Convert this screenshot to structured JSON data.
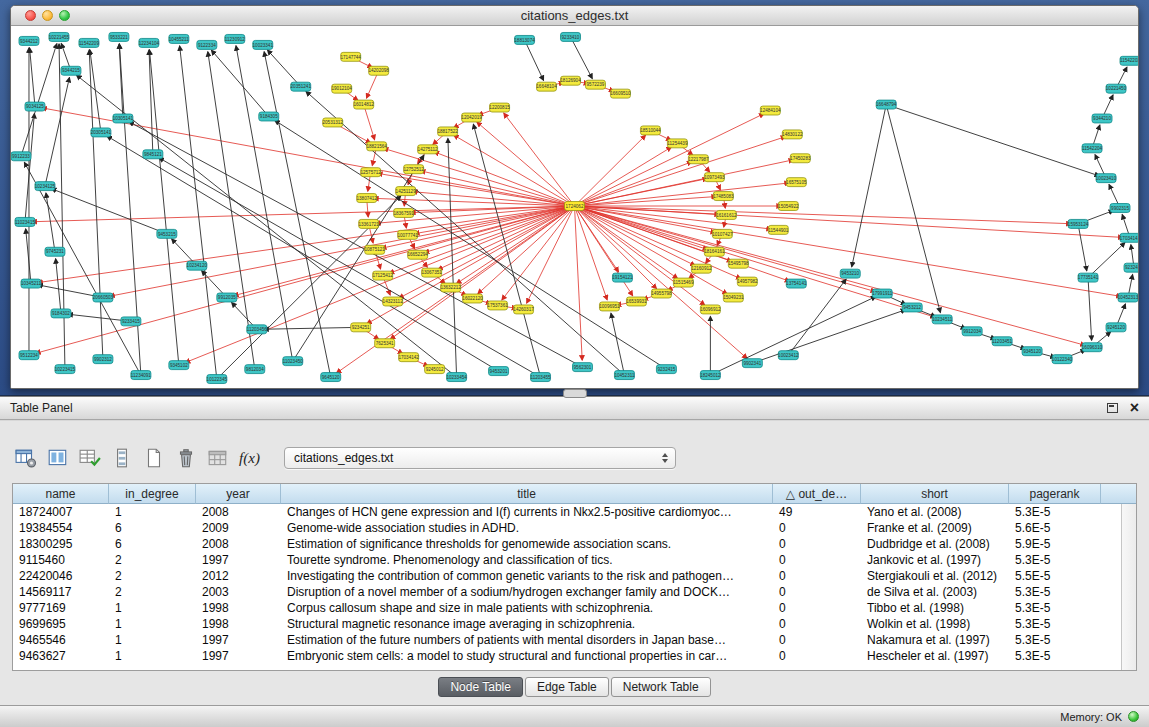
{
  "window": {
    "title": "citations_edges.txt"
  },
  "table_panel": {
    "title": "Table Panel",
    "close_glyph": "×",
    "toolbar": {
      "icons": [
        "table-settings-icon",
        "select-columns-icon",
        "edit-table-icon",
        "rows-icon",
        "new-table-icon",
        "delete-table-icon",
        "import-table-icon",
        "function-builder-icon"
      ],
      "fx_label": "f(x)",
      "table_selector": "citations_edges.txt"
    },
    "table": {
      "sort_glyph": "△",
      "columns": [
        {
          "key": "name",
          "label": "name"
        },
        {
          "key": "in_degree",
          "label": "in_degree"
        },
        {
          "key": "year",
          "label": "year"
        },
        {
          "key": "title",
          "label": "title"
        },
        {
          "key": "out_degree",
          "label": "out_de…",
          "sorted": true
        },
        {
          "key": "short",
          "label": "short"
        },
        {
          "key": "pagerank",
          "label": "pagerank"
        }
      ],
      "rows": [
        [
          "18724007",
          "1",
          "2008",
          "Changes of HCN gene expression and I(f) currents in Nkx2.5-positive cardiomyoc…",
          "49",
          "Yano et al. (2008)",
          "5.3E-5"
        ],
        [
          "19384554",
          "6",
          "2009",
          "Genome-wide association studies in ADHD.",
          "0",
          "Franke et al. (2009)",
          "5.6E-5"
        ],
        [
          "18300295",
          "6",
          "2008",
          "Estimation of significance thresholds for genomewide association scans.",
          "0",
          "Dudbridge et al. (2008)",
          "5.9E-5"
        ],
        [
          "9115460",
          "2",
          "1997",
          "Tourette syndrome. Phenomenology and classification of tics.",
          "0",
          "Jankovic et al. (1997)",
          "5.3E-5"
        ],
        [
          "22420046",
          "2",
          "2012",
          "Investigating the contribution of common genetic variants to the risk and pathogen…",
          "0",
          "Stergiakouli et al. (2012)",
          "5.5E-5"
        ],
        [
          "14569117",
          "2",
          "2003",
          "Disruption of a novel member of a sodium/hydrogen exchanger family and DOCK…",
          "0",
          "de Silva et al. (2003)",
          "5.3E-5"
        ],
        [
          "9777169",
          "1",
          "1998",
          "Corpus callosum shape and size in male patients with schizophrenia.",
          "0",
          "Tibbo et al. (1998)",
          "5.3E-5"
        ],
        [
          "9699695",
          "1",
          "1998",
          "Structural magnetic resonance image averaging in schizophrenia.",
          "0",
          "Wolkin et al. (1998)",
          "5.3E-5"
        ],
        [
          "9465546",
          "1",
          "1997",
          "Estimation of the future numbers of patients with mental disorders in Japan base…",
          "0",
          "Nakamura et al. (1997)",
          "5.3E-5"
        ],
        [
          "9463627",
          "1",
          "1997",
          "Embryonic stem cells: a model to study structural and functional properties in car…",
          "0",
          "Hescheler et al. (1997)",
          "5.3E-5"
        ]
      ]
    },
    "tabs": [
      {
        "label": "Node Table",
        "selected": true
      },
      {
        "label": "Edge Table",
        "selected": false
      },
      {
        "label": "Network Table",
        "selected": false
      }
    ]
  },
  "status_bar": {
    "memory_label": "Memory: OK"
  },
  "colors": {
    "node_teal": "#3ec6c6",
    "node_teal_border": "#0c8888",
    "node_yellow": "#f4ea3e",
    "node_yellow_border": "#96960f",
    "hub_yellow": "#ffe92e",
    "edge_red": "#e03028",
    "edge_black": "#2a2a2a"
  },
  "network": {
    "hub_index": 0,
    "nodes": [
      [
        564,
        180,
        "y",
        "1724062"
      ],
      [
        640,
        104,
        "y",
        "18510044"
      ],
      [
        667,
        117,
        "y",
        "11254439"
      ],
      [
        688,
        133,
        "y",
        "12217987"
      ],
      [
        704,
        151,
        "y",
        "10973493"
      ],
      [
        713,
        170,
        "y",
        "17485083"
      ],
      [
        716,
        189,
        "y",
        "16161612"
      ],
      [
        712,
        208,
        "y",
        "10107427"
      ],
      [
        704,
        226,
        "y",
        "18164161"
      ],
      [
        691,
        243,
        "y",
        "12160912"
      ],
      [
        673,
        257,
        "y",
        "11515469"
      ],
      [
        651,
        268,
        "y",
        "14955798"
      ],
      [
        626,
        276,
        "y",
        "16539931"
      ],
      [
        599,
        281,
        "y",
        "10096951"
      ],
      [
        489,
        81,
        "y",
        "12200815"
      ],
      [
        461,
        91,
        "y",
        "12042019"
      ],
      [
        437,
        105,
        "y",
        "18817522"
      ],
      [
        417,
        123,
        "y",
        "14275112"
      ],
      [
        403,
        143,
        "y",
        "12752512"
      ],
      [
        395,
        165,
        "y",
        "14251129"
      ],
      [
        393,
        187,
        "y",
        "18367591"
      ],
      [
        397,
        209,
        "y",
        "10077741"
      ],
      [
        407,
        229,
        "y",
        "16652294"
      ],
      [
        421,
        247,
        "y",
        "13067351"
      ],
      [
        440,
        262,
        "y",
        "13632212"
      ],
      [
        462,
        273,
        "y",
        "16022120"
      ],
      [
        487,
        280,
        "y",
        "17537361"
      ],
      [
        513,
        284,
        "y",
        "14260317"
      ],
      [
        536,
        60,
        "y",
        "16648104"
      ],
      [
        560,
        54,
        "y",
        "18126904"
      ],
      [
        585,
        58,
        "y",
        "9572239"
      ],
      [
        610,
        67,
        "y",
        "16609510"
      ],
      [
        340,
        30,
        "y",
        "17147744"
      ],
      [
        368,
        44,
        "y",
        "14202098"
      ],
      [
        331,
        62,
        "y",
        "19012104"
      ],
      [
        353,
        78,
        "y",
        "16014812"
      ],
      [
        322,
        96,
        "y",
        "20531312"
      ],
      [
        366,
        120,
        "y",
        "18821564"
      ],
      [
        360,
        146,
        "y",
        "12575712"
      ],
      [
        356,
        172,
        "y",
        "13807412"
      ],
      [
        358,
        198,
        "y",
        "13361721"
      ],
      [
        364,
        224,
        "y",
        "10875121"
      ],
      [
        372,
        250,
        "y",
        "17125412"
      ],
      [
        382,
        276,
        "y",
        "14323112"
      ],
      [
        760,
        84,
        "y",
        "12484104"
      ],
      [
        782,
        108,
        "y",
        "14830122"
      ],
      [
        790,
        132,
        "y",
        "17450283"
      ],
      [
        786,
        156,
        "y",
        "16575105"
      ],
      [
        778,
        180,
        "y",
        "15054922"
      ],
      [
        768,
        204,
        "y",
        "11544901"
      ],
      [
        350,
        302,
        "y",
        "9234251"
      ],
      [
        374,
        318,
        "y",
        "7625341"
      ],
      [
        398,
        332,
        "y",
        "17034142"
      ],
      [
        424,
        344,
        "y",
        "9245012"
      ],
      [
        728,
        238,
        "y",
        "15495798"
      ],
      [
        737,
        256,
        "y",
        "14957982"
      ],
      [
        723,
        272,
        "y",
        "15049231"
      ],
      [
        700,
        284,
        "y",
        "16096912"
      ],
      [
        18,
        14,
        "t",
        "9344212"
      ],
      [
        48,
        10,
        "t",
        "10221455"
      ],
      [
        78,
        16,
        "t",
        "11542209"
      ],
      [
        108,
        10,
        "t",
        "9533221"
      ],
      [
        138,
        16,
        "t",
        "12234104"
      ],
      [
        168,
        12,
        "t",
        "10455211"
      ],
      [
        196,
        18,
        "t",
        "9122334"
      ],
      [
        224,
        12,
        "t",
        "11230912"
      ],
      [
        252,
        18,
        "t",
        "10023341"
      ],
      [
        24,
        80,
        "t",
        "9034125"
      ],
      [
        10,
        130,
        "t",
        "9912233"
      ],
      [
        34,
        160,
        "t",
        "10234125"
      ],
      [
        14,
        196,
        "t",
        "11023415"
      ],
      [
        44,
        226,
        "t",
        "9745231"
      ],
      [
        20,
        258,
        "t",
        "10345211"
      ],
      [
        50,
        288,
        "t",
        "9184302"
      ],
      [
        92,
        272,
        "t",
        "20660503"
      ],
      [
        120,
        296,
        "t",
        "9233415"
      ],
      [
        18,
        330,
        "t",
        "9512234"
      ],
      [
        54,
        344,
        "t",
        "10223415"
      ],
      [
        92,
        334,
        "t",
        "9902312"
      ],
      [
        130,
        350,
        "t",
        "11234091"
      ],
      [
        168,
        340,
        "t",
        "9345102"
      ],
      [
        206,
        354,
        "t",
        "10122345"
      ],
      [
        244,
        344,
        "t",
        "9812034"
      ],
      [
        282,
        336,
        "t",
        "11023450"
      ],
      [
        320,
        352,
        "t",
        "9645120"
      ],
      [
        446,
        352,
        "t",
        "10233454"
      ],
      [
        488,
        346,
        "t",
        "9453201"
      ],
      [
        530,
        352,
        "t",
        "11203455"
      ],
      [
        572,
        342,
        "t",
        "9562301"
      ],
      [
        614,
        350,
        "t",
        "10452311"
      ],
      [
        656,
        344,
        "t",
        "9232415"
      ],
      [
        700,
        350,
        "t",
        "18245012"
      ],
      [
        742,
        338,
        "t",
        "9902341"
      ],
      [
        778,
        330,
        "t",
        "10023412"
      ],
      [
        872,
        268,
        "t",
        "17991911"
      ],
      [
        902,
        282,
        "t",
        "9453212"
      ],
      [
        932,
        294,
        "t",
        "10234511"
      ],
      [
        962,
        306,
        "t",
        "9912034"
      ],
      [
        992,
        316,
        "t",
        "11203451"
      ],
      [
        1022,
        326,
        "t",
        "9345120"
      ],
      [
        1052,
        334,
        "t",
        "10122340"
      ],
      [
        1082,
        322,
        "t",
        "16096310"
      ],
      [
        1106,
        302,
        "t",
        "9245120"
      ],
      [
        1118,
        272,
        "t",
        "10452313"
      ],
      [
        1124,
        242,
        "t",
        "9232410"
      ],
      [
        1120,
        212,
        "t",
        "17034141"
      ],
      [
        1110,
        182,
        "t",
        "9902315"
      ],
      [
        1096,
        152,
        "t",
        "10023410"
      ],
      [
        1082,
        122,
        "t",
        "11542204"
      ],
      [
        1092,
        92,
        "t",
        "9344210"
      ],
      [
        1106,
        62,
        "t",
        "10221450"
      ],
      [
        1120,
        34,
        "t",
        "11542203"
      ],
      [
        1078,
        252,
        "t",
        "17735141"
      ],
      [
        876,
        78,
        "t",
        "16648794"
      ],
      [
        1068,
        198,
        "t",
        "15953124"
      ],
      [
        840,
        248,
        "t",
        "9453210"
      ],
      [
        612,
        252,
        "t",
        "19154121"
      ],
      [
        786,
        258,
        "t",
        "13754141"
      ],
      [
        90,
        106,
        "t",
        "20305141"
      ],
      [
        142,
        128,
        "t",
        "9845121"
      ],
      [
        112,
        92,
        "t",
        "10305141"
      ],
      [
        60,
        44,
        "t",
        "9344215"
      ],
      [
        514,
        13,
        "t",
        "18813074"
      ],
      [
        560,
        10,
        "t",
        "9233410"
      ],
      [
        290,
        60,
        "t",
        "20351241"
      ],
      [
        258,
        90,
        "t",
        "9184305"
      ],
      [
        156,
        208,
        "t",
        "9453215"
      ],
      [
        186,
        240,
        "t",
        "10234120"
      ],
      [
        216,
        272,
        "t",
        "9912035"
      ],
      [
        246,
        304,
        "t",
        "11203456"
      ]
    ],
    "edges": {
      "red_spokes_from": 0,
      "red_spokes_to": [
        1,
        2,
        3,
        4,
        5,
        6,
        7,
        8,
        9,
        10,
        11,
        12,
        13,
        14,
        15,
        16,
        17,
        18,
        19,
        20,
        21,
        22,
        23,
        24,
        25,
        26,
        27,
        37,
        38,
        39,
        40,
        41,
        42,
        43,
        44,
        45,
        46,
        47,
        48,
        49,
        54,
        55,
        56,
        57,
        67,
        70,
        72,
        74,
        76,
        80,
        84,
        88,
        92,
        94,
        96,
        101,
        103,
        105,
        114,
        116,
        117,
        50,
        51,
        128
      ],
      "red_chains": [
        [
          1,
          2,
          3,
          4,
          5,
          6,
          7,
          8,
          9,
          10,
          11,
          12,
          13
        ],
        [
          14,
          15,
          16,
          17,
          18,
          19,
          20,
          21,
          22,
          23,
          24,
          25,
          26,
          27
        ],
        [
          28,
          29,
          30,
          31
        ],
        [
          37,
          38,
          39,
          40,
          41,
          42,
          43
        ],
        [
          32,
          33,
          35,
          37
        ],
        [
          34,
          35
        ],
        [
          36,
          37
        ],
        [
          50,
          51,
          52,
          53
        ]
      ],
      "black_chains": [
        [
          94,
          95,
          96,
          97,
          98,
          99,
          100,
          101,
          102,
          103,
          104,
          105,
          106,
          107,
          108,
          109,
          110,
          111
        ],
        [
          75,
          73,
          71,
          69,
          121
        ],
        [
          74,
          72,
          70,
          67,
          58
        ],
        [
          129,
          128,
          127,
          126,
          69
        ]
      ],
      "black_pairs": [
        [
          76,
          58
        ],
        [
          77,
          59
        ],
        [
          78,
          60
        ],
        [
          79,
          61
        ],
        [
          80,
          62
        ],
        [
          81,
          63
        ],
        [
          82,
          64
        ],
        [
          83,
          65
        ],
        [
          84,
          66
        ],
        [
          85,
          121
        ],
        [
          86,
          118
        ],
        [
          87,
          119
        ],
        [
          88,
          120
        ],
        [
          89,
          124
        ],
        [
          90,
          125
        ],
        [
          113,
          96
        ],
        [
          113,
          107
        ],
        [
          113,
          115
        ],
        [
          91,
          94
        ],
        [
          92,
          95
        ],
        [
          93,
          115
        ],
        [
          112,
          101
        ],
        [
          112,
          105
        ],
        [
          114,
          106
        ],
        [
          114,
          112
        ],
        [
          118,
          60
        ],
        [
          119,
          62
        ],
        [
          120,
          61
        ],
        [
          124,
          66
        ],
        [
          125,
          64
        ],
        [
          121,
          59
        ],
        [
          68,
          59
        ],
        [
          83,
          17
        ],
        [
          81,
          19
        ],
        [
          79,
          68
        ],
        [
          85,
          16
        ],
        [
          87,
          15
        ],
        [
          122,
          28
        ],
        [
          123,
          30
        ],
        [
          89,
          13
        ],
        [
          91,
          57
        ],
        [
          50,
          129
        ]
      ]
    }
  }
}
